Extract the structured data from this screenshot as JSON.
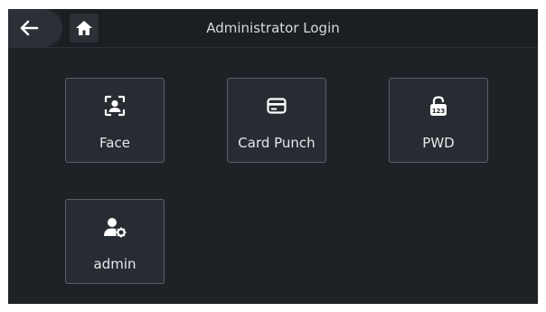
{
  "header": {
    "title": "Administrator Login",
    "back_icon": "back-arrow-icon",
    "home_icon": "home-icon"
  },
  "login_methods": [
    {
      "label": "Face",
      "icon": "face-scan-icon"
    },
    {
      "label": "Card Punch",
      "icon": "card-icon"
    },
    {
      "label": "PWD",
      "icon": "password-lock-icon",
      "icon_text": "123"
    },
    {
      "label": "admin",
      "icon": "admin-user-icon"
    }
  ],
  "colors": {
    "background": "#1e2227",
    "tile_border": "#5a6068",
    "text": "#e6e8ea"
  }
}
